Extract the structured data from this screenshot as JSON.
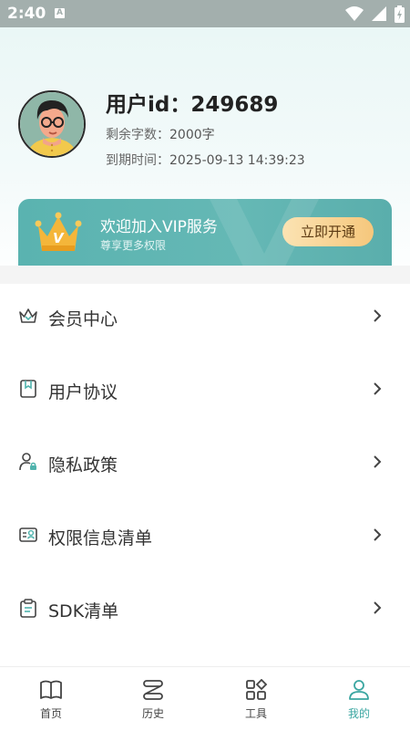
{
  "status_bar": {
    "time": "2:40",
    "notification_badge": "A"
  },
  "profile": {
    "user_id_text": "用户id：249689",
    "remaining_label": "剩余字数：",
    "remaining_value": "2000字",
    "expiry_label": "到期时间：",
    "expiry_value": "2025-09-13 14:39:23"
  },
  "vip": {
    "title": "欢迎加入VIP服务",
    "subtitle": "尊享更多权限",
    "button_label": "立即开通",
    "crown_letter": "V",
    "gradient_start": "#5ab3b0",
    "button_color": "#f6c77c"
  },
  "menu": {
    "items": [
      {
        "label": "会员中心",
        "icon": "crown-icon"
      },
      {
        "label": "用户协议",
        "icon": "bookmark-icon"
      },
      {
        "label": "隐私政策",
        "icon": "user-lock-icon"
      },
      {
        "label": "权限信息清单",
        "icon": "id-card-icon"
      },
      {
        "label": "SDK清单",
        "icon": "clipboard-icon"
      }
    ]
  },
  "bottom_nav": {
    "items": [
      {
        "label": "首页",
        "icon": "book-icon",
        "active": false
      },
      {
        "label": "历史",
        "icon": "history-icon",
        "active": false
      },
      {
        "label": "工具",
        "icon": "tools-grid-icon",
        "active": false
      },
      {
        "label": "我的",
        "icon": "profile-icon",
        "active": true
      }
    ],
    "active_color": "#3aa6a1"
  }
}
